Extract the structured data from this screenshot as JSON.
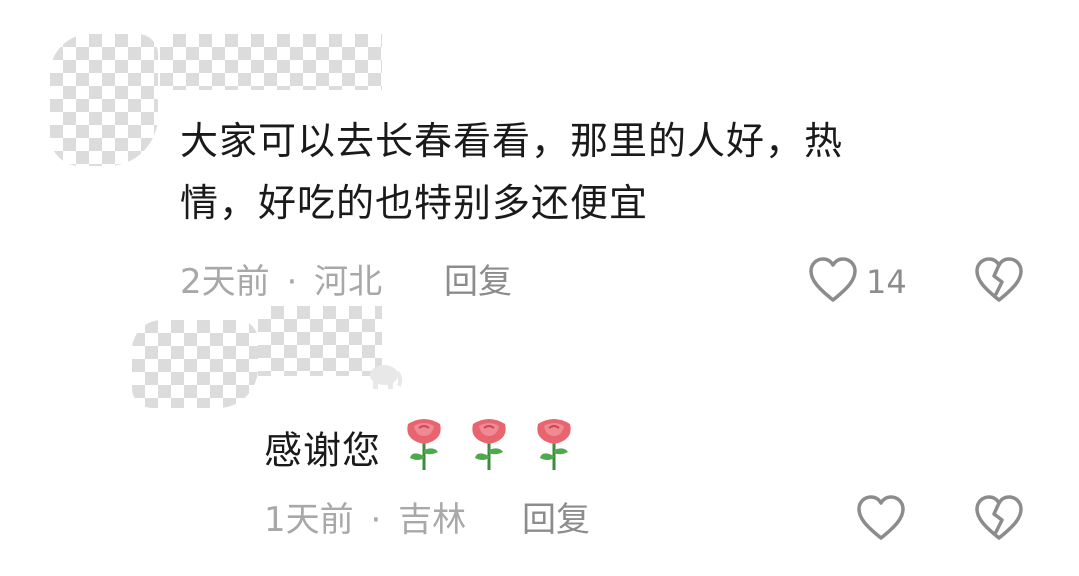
{
  "comments": [
    {
      "text_line1": "大家可以去长春看看，那里的人好，热",
      "text_line2": "情，好吃的也特别多还便宜",
      "time": "2天前",
      "separator": "·",
      "location": "河北",
      "reply_label": "回复",
      "like_count": "14"
    },
    {
      "text": "感谢您",
      "emoji": [
        "rose-icon",
        "rose-icon",
        "rose-icon"
      ],
      "time": "1天前",
      "separator": "·",
      "location": "吉林",
      "reply_label": "回复"
    }
  ],
  "colors": {
    "text": "#1a1a1a",
    "meta": "#a8a8a8",
    "icon": "#8c8c8c",
    "rose": "#e8646e"
  }
}
